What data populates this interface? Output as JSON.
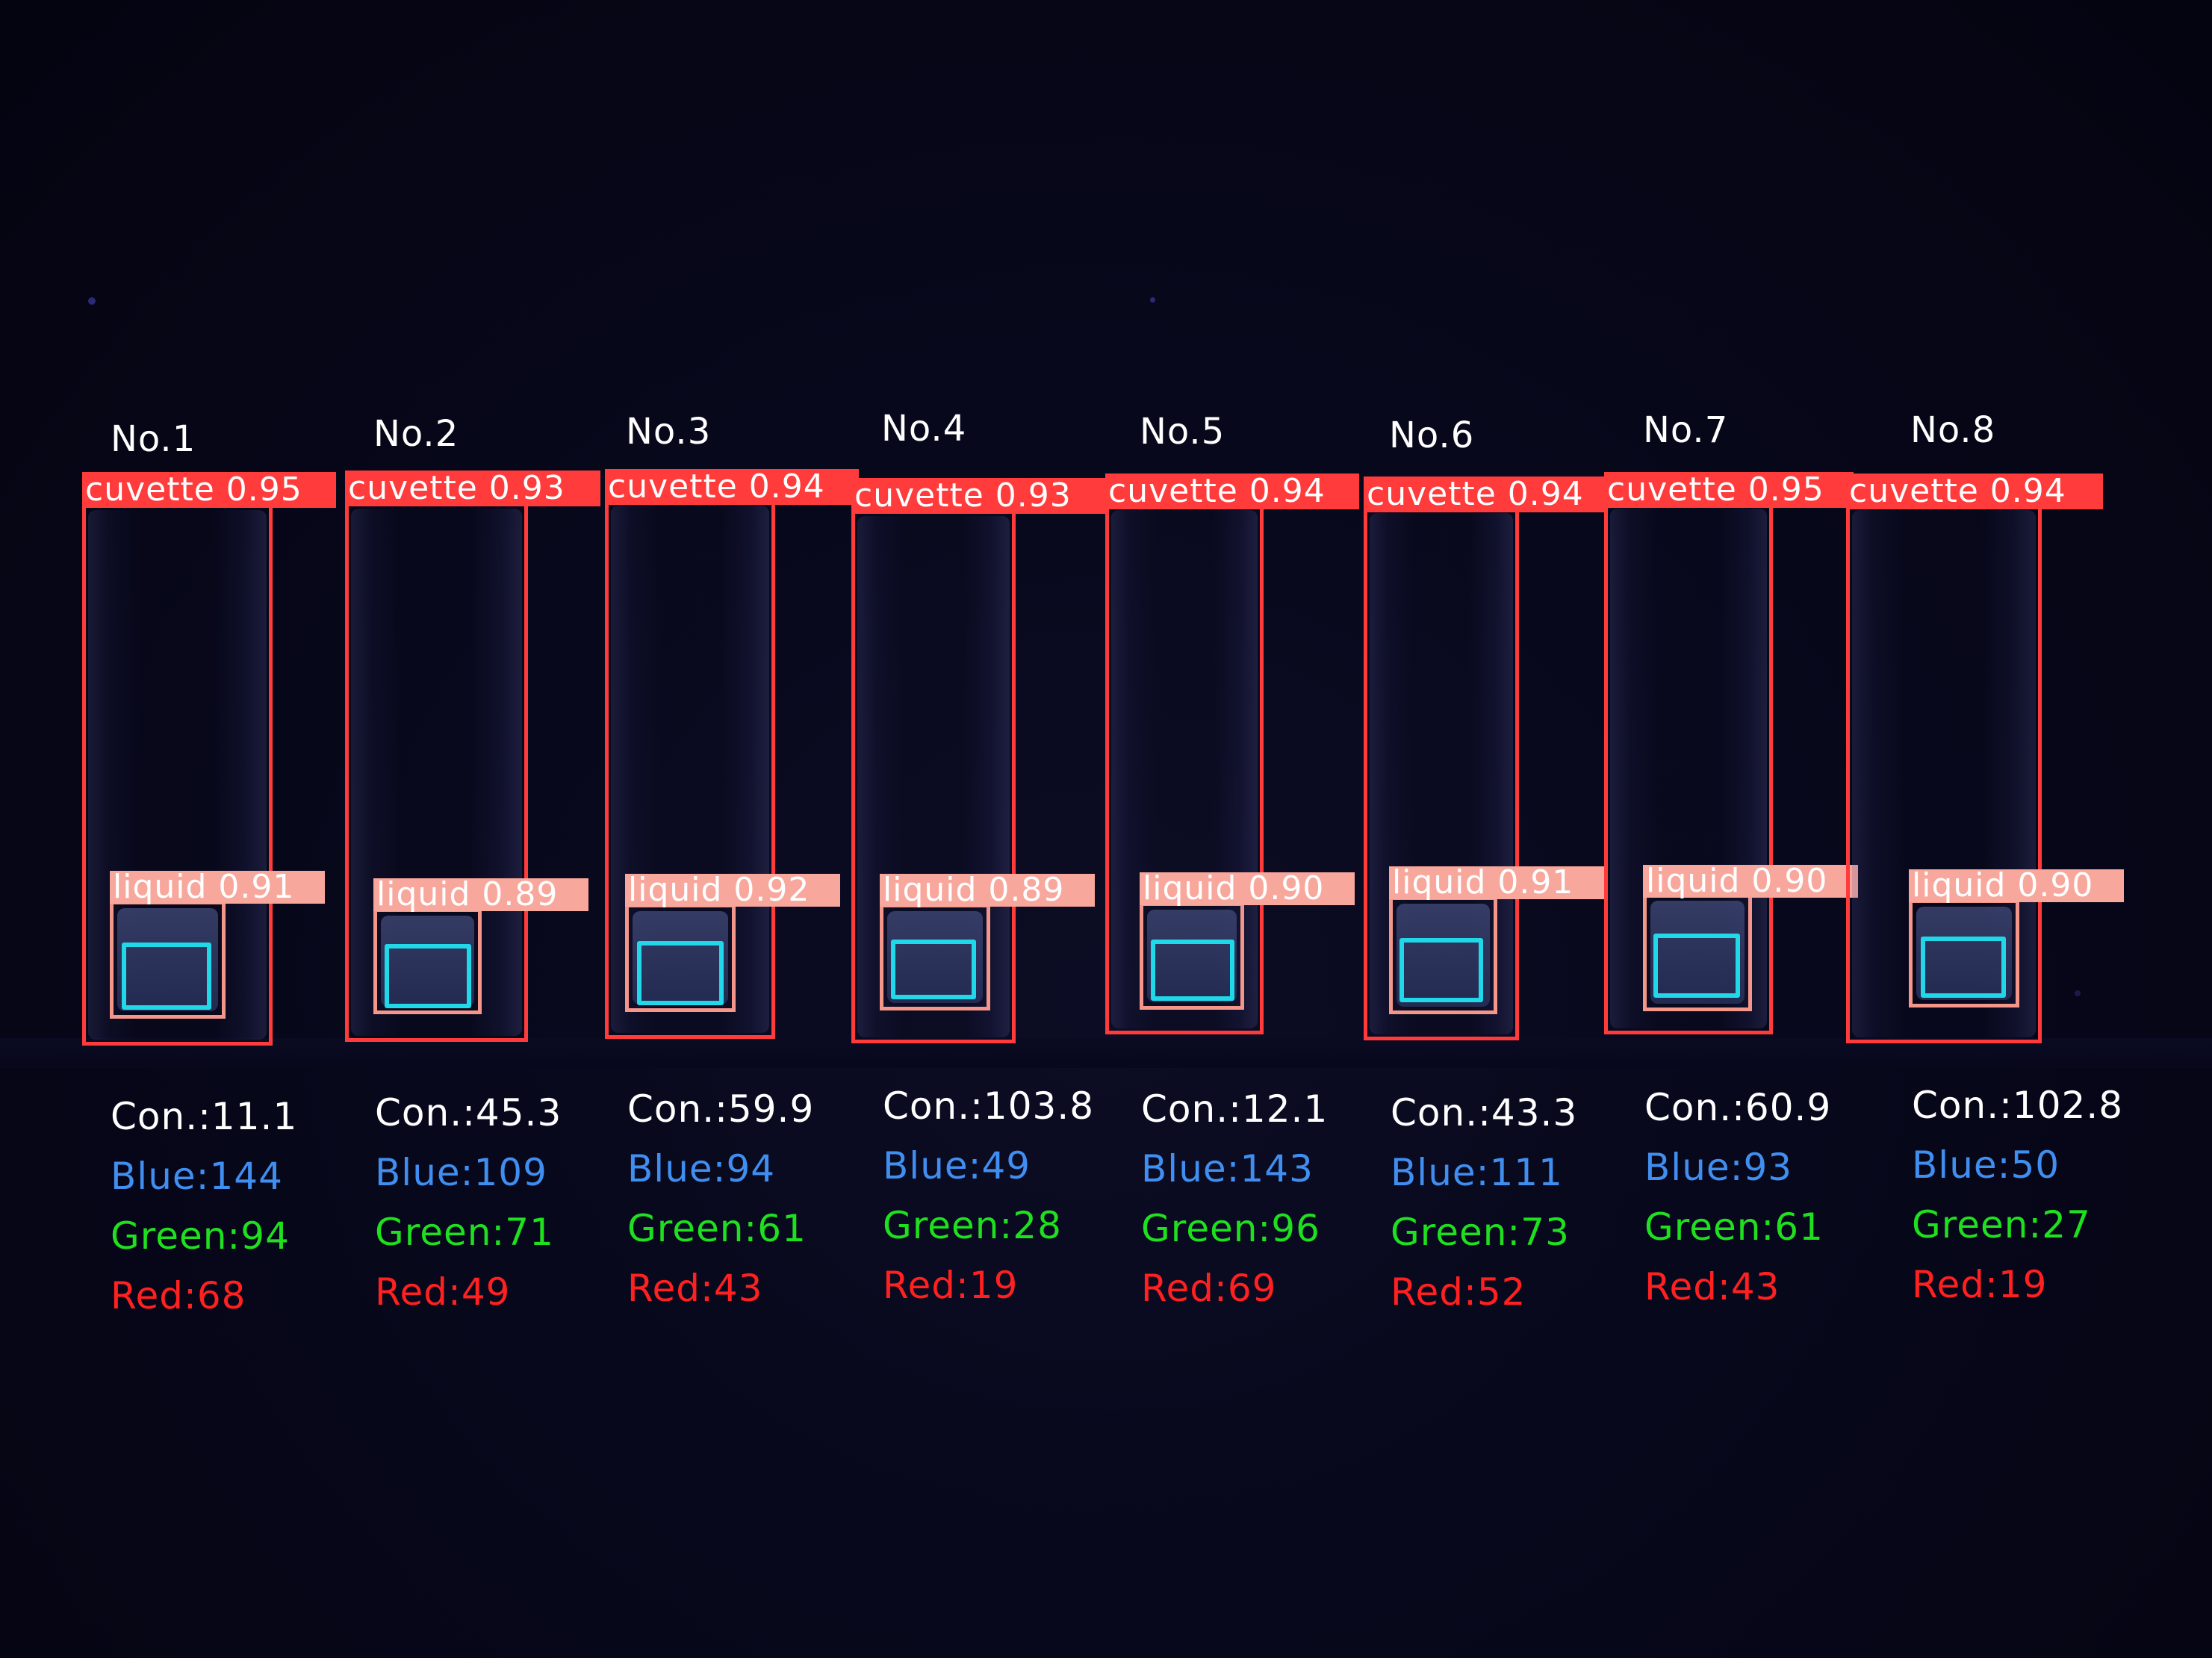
{
  "colors": {
    "cuvette_box": "#ff3b3b",
    "liquid_box": "#f4968a",
    "roi_box": "#20d8e8",
    "con_text": "#ffffff",
    "blue_text": "#3f8ef0",
    "green_text": "#1fe01f",
    "red_text": "#ff2020"
  },
  "samples": [
    {
      "no": "No.1",
      "cuvette_label": "cuvette 0.95",
      "liquid_label": "liquid 0.91",
      "con": "Con.:11.1",
      "blue": "Blue:144",
      "green": "Green:94",
      "red": "Red:68"
    },
    {
      "no": "No.2",
      "cuvette_label": "cuvette 0.93",
      "liquid_label": "liquid 0.89",
      "con": "Con.:45.3",
      "blue": "Blue:109",
      "green": "Green:71",
      "red": "Red:49"
    },
    {
      "no": "No.3",
      "cuvette_label": "cuvette 0.94",
      "liquid_label": "liquid 0.92",
      "con": "Con.:59.9",
      "blue": "Blue:94",
      "green": "Green:61",
      "red": "Red:43"
    },
    {
      "no": "No.4",
      "cuvette_label": "cuvette 0.93",
      "liquid_label": "liquid 0.89",
      "con": "Con.:103.8",
      "blue": "Blue:49",
      "green": "Green:28",
      "red": "Red:19"
    },
    {
      "no": "No.5",
      "cuvette_label": "cuvette 0.94",
      "liquid_label": "liquid 0.90",
      "con": "Con.:12.1",
      "blue": "Blue:143",
      "green": "Green:96",
      "red": "Red:69"
    },
    {
      "no": "No.6",
      "cuvette_label": "cuvette 0.94",
      "liquid_label": "liquid 0.91",
      "con": "Con.:43.3",
      "blue": "Blue:111",
      "green": "Green:73",
      "red": "Red:52"
    },
    {
      "no": "No.7",
      "cuvette_label": "cuvette 0.95",
      "liquid_label": "liquid 0.90",
      "con": "Con.:60.9",
      "blue": "Blue:93",
      "green": "Green:61",
      "red": "Red:43"
    },
    {
      "no": "No.8",
      "cuvette_label": "cuvette 0.94",
      "liquid_label": "liquid 0.90",
      "con": "Con.:102.8",
      "blue": "Blue:50",
      "green": "Green:27",
      "red": "Red:19"
    }
  ]
}
